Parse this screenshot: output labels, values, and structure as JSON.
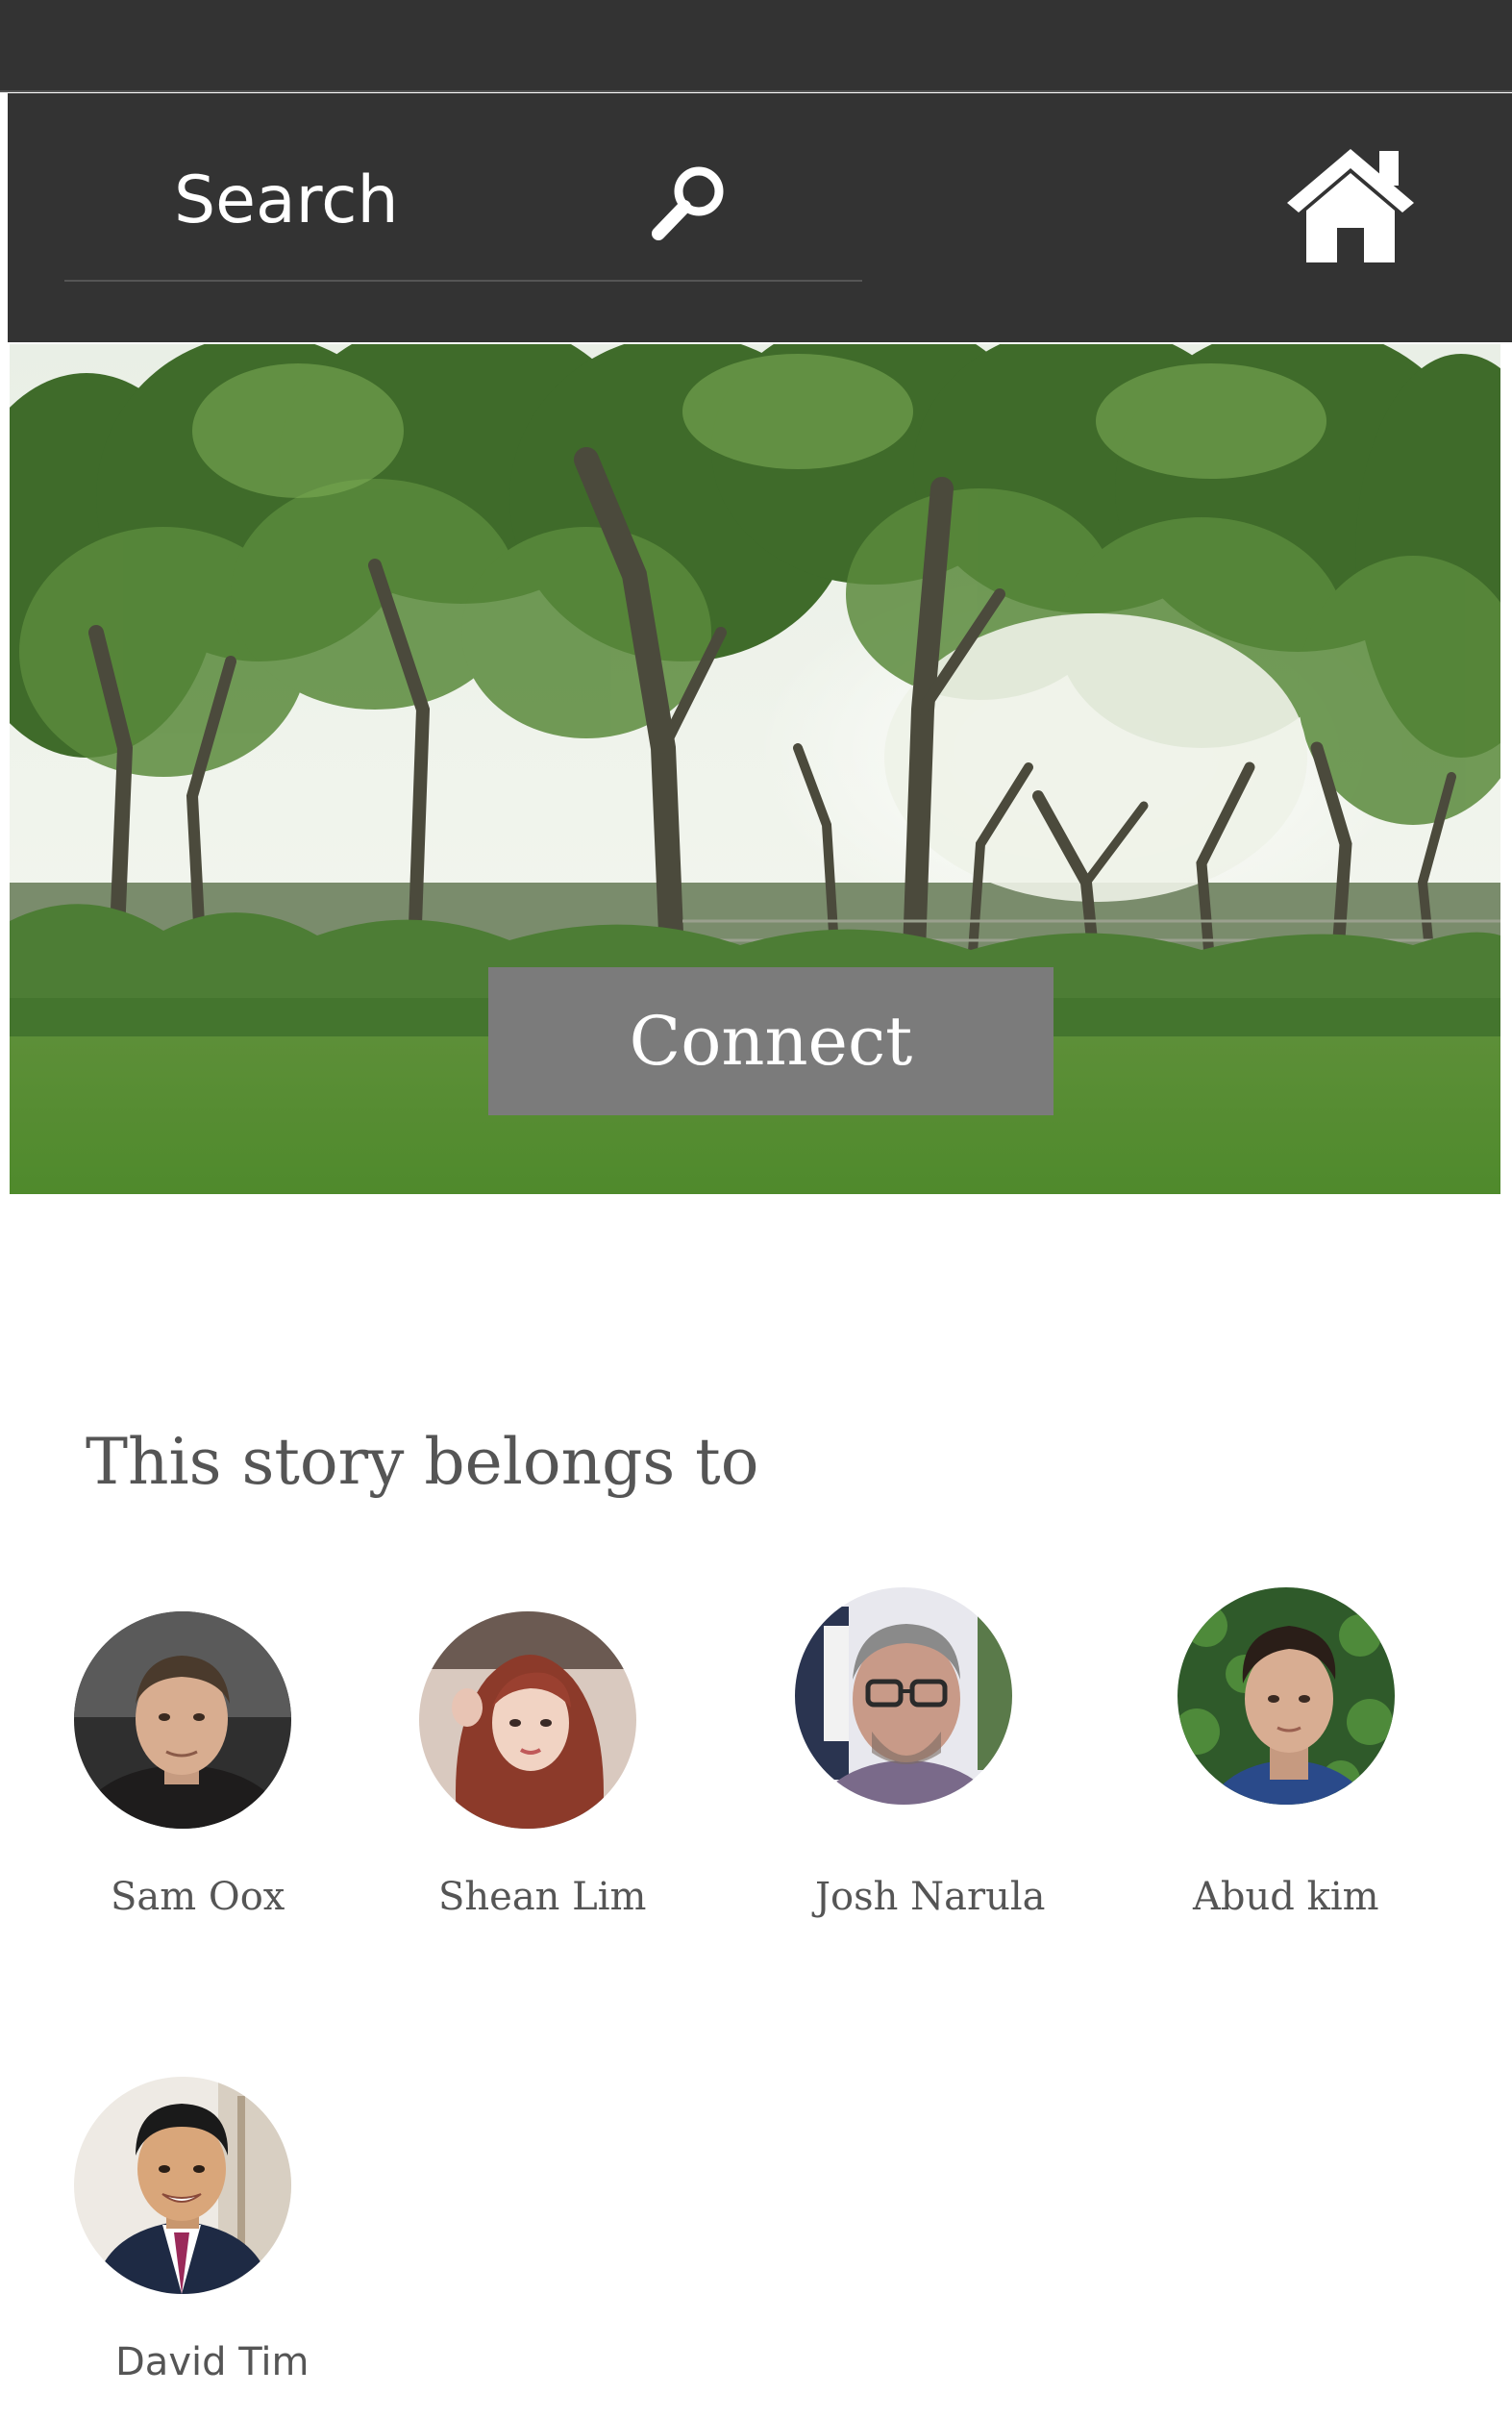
{
  "header": {
    "search_placeholder": "Search",
    "search_icon": "search-icon",
    "home_icon": "home-icon"
  },
  "hero": {
    "image": "trees-landscape-photo",
    "connect_label": "Connect"
  },
  "members_section": {
    "title": "This story belongs to",
    "members": [
      {
        "name": "Sam Oox"
      },
      {
        "name": "Shean Lim"
      },
      {
        "name": "Josh Narula"
      },
      {
        "name": "Abud kim"
      },
      {
        "name": "David  Tim"
      }
    ]
  },
  "colors": {
    "header_bg": "#333333",
    "button_bg": "#7b7b7b",
    "text_gray": "#555555"
  }
}
